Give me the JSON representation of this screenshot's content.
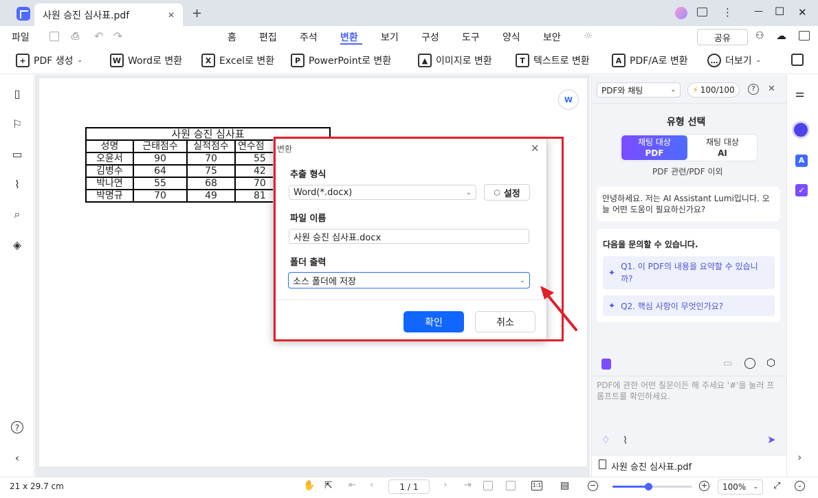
{
  "tab": {
    "title": "사원 승진 심사표.pdf",
    "close": "✕",
    "new_tab": "+"
  },
  "window": {
    "minimize": "—",
    "maximize": "☐",
    "close": "✕"
  },
  "menu": {
    "file": "파일",
    "items": [
      "홈",
      "편집",
      "주석",
      "변환",
      "보기",
      "구성",
      "도구",
      "양식",
      "보안"
    ],
    "active": "변환",
    "share": "공유"
  },
  "toolbar": {
    "pdf_create": "PDF 생성",
    "word": "Word로 변환",
    "excel": "Excel로 변환",
    "ppt": "PowerPoint로 변환",
    "image": "이미지로 변환",
    "text": "텍스트로 변환",
    "pdfa": "PDF/A로 변환",
    "more": "더보기"
  },
  "pdf_table": {
    "title": "사원 승진 심사표",
    "headers": [
      "성명",
      "근태점수",
      "실적점수",
      "연수점"
    ],
    "rows": [
      [
        "오윤서",
        "90",
        "70",
        "55"
      ],
      [
        "김병수",
        "64",
        "75",
        "42"
      ],
      [
        "박나연",
        "55",
        "68",
        "70"
      ],
      [
        "박명규",
        "70",
        "49",
        "81"
      ]
    ]
  },
  "dialog": {
    "title": "변환",
    "format_label": "추출 형식",
    "format_value": "Word(*.docx)",
    "settings": "설정",
    "filename_label": "파일 이름",
    "filename_value": "사원 승진 심사표.docx",
    "folder_label": "폴더 출력",
    "folder_value": "소스 폴더에 저장",
    "ok": "확인",
    "cancel": "취소"
  },
  "ai_panel": {
    "mode": "PDF와 채팅",
    "credits": "100/100",
    "type_title": "유형 선택",
    "opt1_line1": "채팅 대상",
    "opt1_line2": "PDF",
    "opt2_line1": "채팅 대상",
    "opt2_line2": "AI",
    "opt_caption": "PDF 관련/PDF 이외",
    "greeting": "안녕하세요. 저는 AI Assistant Lumi입니다. 오늘 어떤 도움이 필요하신가요?",
    "ask_title": "다음을 문의할 수 있습니다.",
    "q1": "Q1. 이 PDF의 내용을 요약할 수 있습니까?",
    "q2": "Q2. 핵심 사항이 무엇인가요?",
    "input_placeholder": "PDF에 관한 어떤 질문이든 해 주세요 '#'을 눌러 프롬프트를 확인하세요.",
    "file_name": "사원 승진 심사표.pdf"
  },
  "status": {
    "page_size": "21 x 29.7 cm",
    "page_indicator": "1 / 1",
    "zoom": "100%",
    "zoom_level": 0.45
  },
  "colors": {
    "accent": "#4c63ff",
    "primary_button": "#1166ff",
    "highlight_red": "#e0202a"
  }
}
